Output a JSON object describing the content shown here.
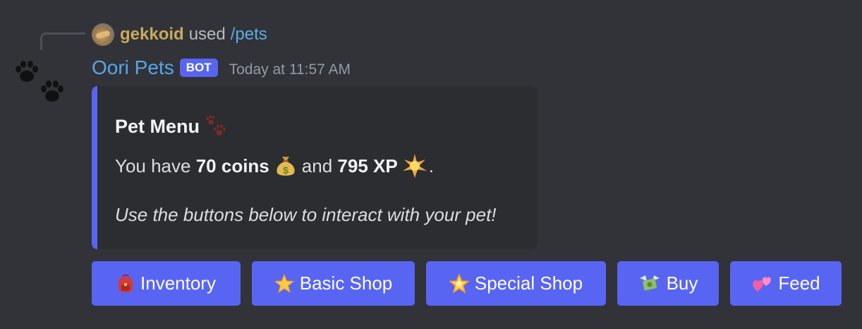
{
  "reply": {
    "username": "gekkoid",
    "used_text": "used",
    "command": "/pets"
  },
  "message": {
    "author": "Oori Pets",
    "tag": "BOT",
    "timestamp": "Today at 11:57 AM",
    "avatar_icon": "paw-prints-icon"
  },
  "embed": {
    "accent_color": "#5865f2",
    "title": "Pet Menu",
    "title_icon": "paw-prints-icon",
    "line_prefix": "You have",
    "coins": "70 coins",
    "coins_icon": "money-bag-icon",
    "and_text": "and",
    "xp": "795 XP",
    "xp_icon": "glowing-star-icon",
    "period": ".",
    "instruction": "Use the buttons below to interact with your pet!"
  },
  "buttons": [
    {
      "label": "Inventory",
      "icon": "backpack-icon"
    },
    {
      "label": "Basic Shop",
      "icon": "star-icon"
    },
    {
      "label": "Special Shop",
      "icon": "glowing-star-icon"
    },
    {
      "label": "Buy",
      "icon": "money-with-wings-icon"
    },
    {
      "label": "Feed",
      "icon": "two-hearts-icon"
    }
  ]
}
